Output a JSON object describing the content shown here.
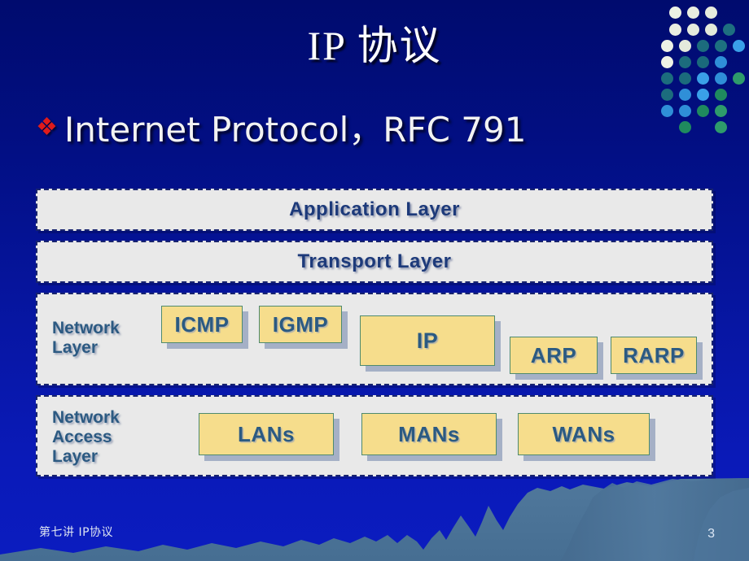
{
  "slide": {
    "title": "IP  协议",
    "background_color": "#02117f",
    "accent_color": "#f6dd8c",
    "bullet_color": "#e01b1b"
  },
  "bullet": {
    "marker": "diamond-bullet",
    "marker_glyph": "❖",
    "text": "Internet Protocol，RFC 791"
  },
  "layers": [
    {
      "id": "application",
      "title": "Application Layer",
      "label": "",
      "boxes": []
    },
    {
      "id": "transport",
      "title": "Transport Layer",
      "label": "",
      "boxes": []
    },
    {
      "id": "network",
      "title": "",
      "label": "Network\nLayer",
      "boxes": [
        {
          "id": "icmp",
          "label": "ICMP"
        },
        {
          "id": "igmp",
          "label": "IGMP"
        },
        {
          "id": "ip",
          "label": "IP"
        },
        {
          "id": "arp",
          "label": "ARP"
        },
        {
          "id": "rarp",
          "label": "RARP"
        }
      ]
    },
    {
      "id": "network-access",
      "title": "",
      "label": "Network\nAccess\nLayer",
      "boxes": [
        {
          "id": "lans",
          "label": "LANs"
        },
        {
          "id": "mans",
          "label": "MANs"
        },
        {
          "id": "wans",
          "label": "WANs"
        }
      ]
    }
  ],
  "footer": {
    "left_text": "第七讲 IP协议",
    "page_number": "3"
  },
  "decoration": {
    "dot_matrix_name": "dot-matrix-ornament",
    "mountain_name": "mountain-silhouette",
    "mountain_color": "#4a7296",
    "dot_colors": [
      "#eef2e6",
      "#1d6e7e",
      "#2f8fd8",
      "#2e9b6b",
      "#1a7f8c",
      "#3aa0e8"
    ]
  }
}
